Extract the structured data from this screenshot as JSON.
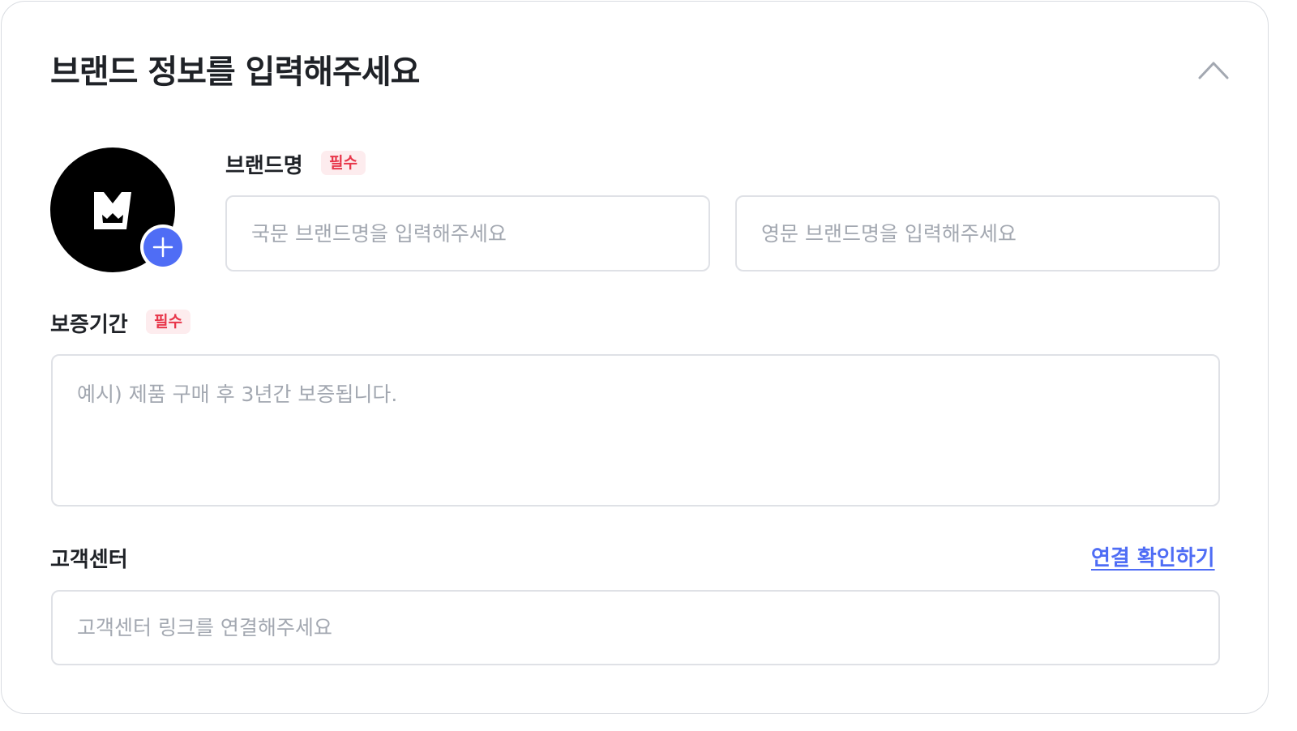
{
  "header": {
    "title": "브랜드 정보를 입력해주세요",
    "collapse_icon": "chevron-up-icon"
  },
  "logo": {
    "avatar_icon": "brand-logo",
    "add_icon": "plus-icon",
    "accent_color": "#4f6df5"
  },
  "brand_name": {
    "label": "브랜드명",
    "badge": "필수",
    "korean_placeholder": "국문 브랜드명을 입력해주세요",
    "korean_value": "",
    "english_placeholder": "영문 브랜드명을 입력해주세요",
    "english_value": ""
  },
  "warranty": {
    "label": "보증기간",
    "badge": "필수",
    "placeholder": "예시) 제품 구매 후 3년간 보증됩니다.",
    "value": ""
  },
  "customer_center": {
    "label": "고객센터",
    "link_label": "연결 확인하기",
    "placeholder": "고객센터 링크를 연결해주세요",
    "value": ""
  },
  "colors": {
    "required_badge_text": "#e8364a",
    "required_badge_bg": "#fdecee",
    "link": "#4f6df5"
  }
}
